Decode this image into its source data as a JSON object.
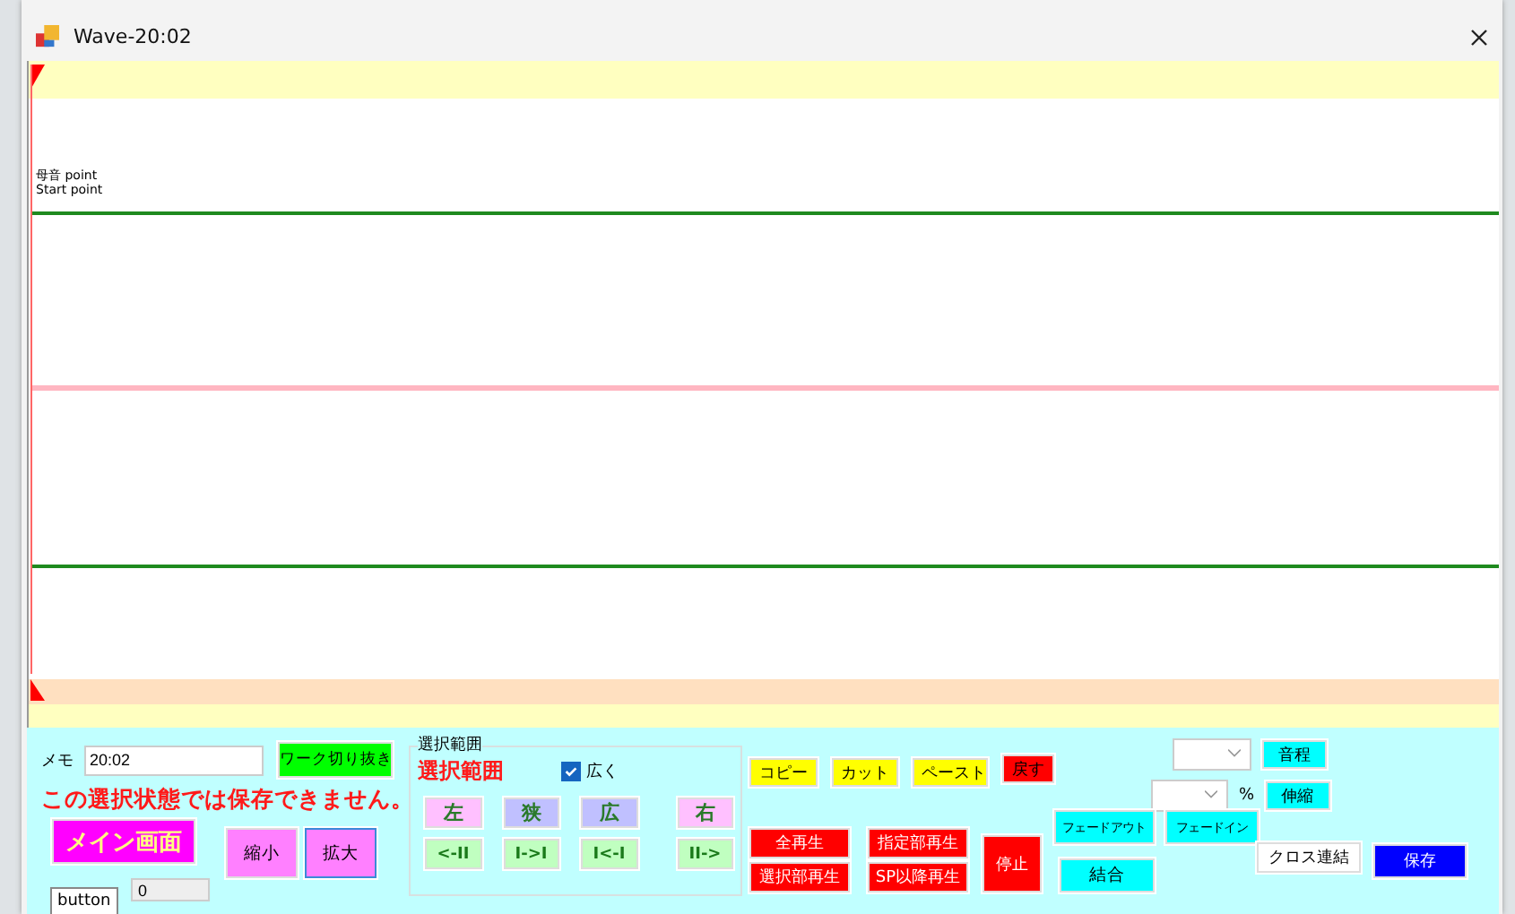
{
  "window": {
    "title": "Wave-20:02"
  },
  "waveform": {
    "labels": [
      "母音 point",
      "Start point"
    ]
  },
  "memo": {
    "label": "メモ",
    "value": "20:02"
  },
  "crop_button": "ワーク切り抜き",
  "warning": "この選択状態では保存できません。",
  "main_button": "メイン画面",
  "zoom_buttons": [
    {
      "label": "縮小",
      "focused": false
    },
    {
      "label": "拡大",
      "focused": true
    }
  ],
  "offset_field": {
    "value": "0"
  },
  "tooltip": "button",
  "selection": {
    "group_title": "選択範囲",
    "heading": "選択範囲",
    "checkbox": {
      "label": "広く",
      "checked": true
    },
    "move_buttons": [
      {
        "label": "左",
        "color": "#ffc0ff"
      },
      {
        "label": "狭",
        "color": "#c0c0ff"
      },
      {
        "label": "広",
        "color": "#c0c0ff"
      },
      {
        "label": "右",
        "color": "#ffc0ff"
      }
    ],
    "step_buttons": [
      "<-II",
      "I->I",
      "I<-I",
      "II->"
    ]
  },
  "edit_buttons": [
    {
      "label": "コピー",
      "color": "#ffff00"
    },
    {
      "label": "カット",
      "color": "#ffff00"
    },
    {
      "label": "ペースト",
      "color": "#ffff00"
    },
    {
      "label": "戻す",
      "color": "#ff0000"
    }
  ],
  "play_buttons": [
    "全再生",
    "指定部再生",
    "選択部再生",
    "SP以降再生"
  ],
  "stop_button": "停止",
  "fade_out_button": "フェードアウト",
  "fade_in_button": "フェードイン",
  "join_button": "結合",
  "pitch_button": "音程",
  "stretch": {
    "unit": "%",
    "button": "伸縮"
  },
  "cross_button": "クロス連結",
  "save_button": "保存"
}
